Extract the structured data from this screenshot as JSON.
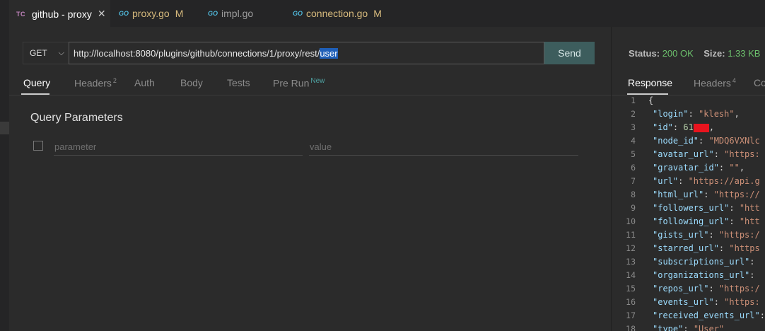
{
  "editor_tabs": [
    {
      "icon": "TC",
      "label": "github - proxy",
      "active": true,
      "modified": false,
      "closable": true
    },
    {
      "icon": "GO",
      "label": "proxy.go",
      "active": false,
      "modified": true,
      "mod_flag": "M"
    },
    {
      "icon": "GO",
      "label": "impl.go",
      "active": false,
      "modified": false
    },
    {
      "icon": "GO",
      "label": "connection.go",
      "active": false,
      "modified": true,
      "mod_flag": "M"
    }
  ],
  "request": {
    "method": "GET",
    "url_prefix": "http://localhost:8080/plugins/github/connections/1/proxy/rest/",
    "url_selected": "user",
    "send_label": "Send",
    "tabs": [
      {
        "label": "Query",
        "active": true
      },
      {
        "label": "Headers",
        "badge": "2"
      },
      {
        "label": "Auth"
      },
      {
        "label": "Body"
      },
      {
        "label": "Tests"
      },
      {
        "label": "Pre Run",
        "badge": "New"
      }
    ],
    "query_title": "Query Parameters",
    "param_placeholder": "parameter",
    "value_placeholder": "value"
  },
  "response": {
    "status_label": "Status:",
    "status_value": "200 OK",
    "size_label": "Size:",
    "size_value": "1.33 KB",
    "tabs": [
      {
        "label": "Response",
        "active": true
      },
      {
        "label": "Headers",
        "badge": "4"
      },
      {
        "label": "Co"
      }
    ],
    "lines": [
      {
        "n": "1",
        "text": "{"
      },
      {
        "n": "2",
        "key": "\"login\"",
        "val": "\"klesh\"",
        "tail": ","
      },
      {
        "n": "3",
        "key": "\"id\"",
        "num": "61",
        "redacted": true,
        "tail": ","
      },
      {
        "n": "4",
        "key": "\"node_id\"",
        "val": "\"MDQ6VXNlc"
      },
      {
        "n": "5",
        "key": "\"avatar_url\"",
        "val": "\"https:"
      },
      {
        "n": "6",
        "key": "\"gravatar_id\"",
        "val": "\"\"",
        "tail": ","
      },
      {
        "n": "7",
        "key": "\"url\"",
        "val": "\"https://api.g"
      },
      {
        "n": "8",
        "key": "\"html_url\"",
        "val": "\"https://"
      },
      {
        "n": "9",
        "key": "\"followers_url\"",
        "val": "\"htt"
      },
      {
        "n": "10",
        "key": "\"following_url\"",
        "val": "\"htt"
      },
      {
        "n": "11",
        "key": "\"gists_url\"",
        "val": "\"https:/"
      },
      {
        "n": "12",
        "key": "\"starred_url\"",
        "val": "\"https"
      },
      {
        "n": "13",
        "key": "\"subscriptions_url\"",
        "val": ""
      },
      {
        "n": "14",
        "key": "\"organizations_url\"",
        "val": ""
      },
      {
        "n": "15",
        "key": "\"repos_url\"",
        "val": "\"https:/"
      },
      {
        "n": "16",
        "key": "\"events_url\"",
        "val": "\"https:"
      },
      {
        "n": "17",
        "key": "\"received_events_url\"",
        "val": ""
      },
      {
        "n": "18",
        "key": "\"type\"",
        "val": "\"User\""
      }
    ]
  }
}
